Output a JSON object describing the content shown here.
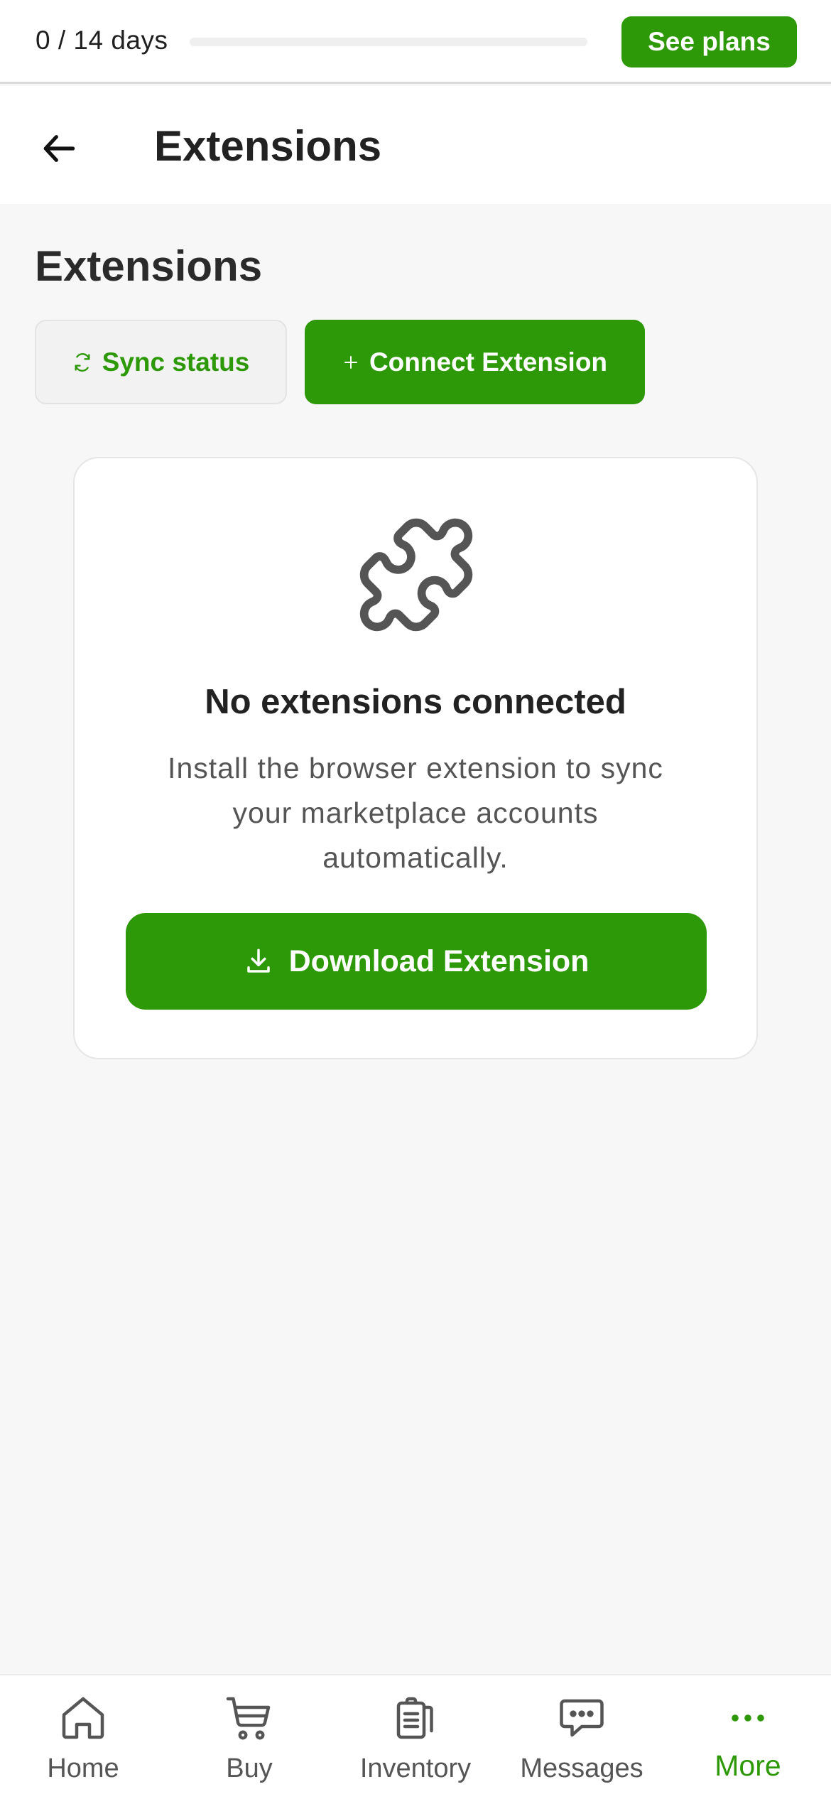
{
  "trial": {
    "label": "0 / 14 days",
    "progress_fraction": 0,
    "cta_label": "See plans"
  },
  "header": {
    "back_icon": "arrow-left-icon",
    "title": "Extensions"
  },
  "main": {
    "section_title": "Extensions",
    "actions": {
      "sync_label": "Sync status",
      "sync_icon": "refresh-icon",
      "connect_label": "Connect Extension",
      "connect_icon": "plus-icon"
    },
    "empty_state": {
      "icon": "puzzle-piece-icon",
      "title": "No extensions connected",
      "description": "Install the browser extension to sync your marketplace accounts automatically.",
      "button_label": "Download Extension",
      "button_icon": "download-icon"
    }
  },
  "bottom_nav": {
    "items": [
      {
        "label": "Home",
        "icon": "home-icon"
      },
      {
        "label": "Buy",
        "icon": "cart-icon"
      },
      {
        "label": "Inventory",
        "icon": "clipboard-icon"
      },
      {
        "label": "Messages",
        "icon": "chat-bubble-icon"
      },
      {
        "label": "More",
        "icon": "more-dots-icon",
        "active": true
      }
    ]
  },
  "colors": {
    "accent": "#2e9908",
    "background": "#f7f7f7",
    "surface": "#ffffff",
    "text_primary": "#222222",
    "text_secondary": "#555555"
  }
}
